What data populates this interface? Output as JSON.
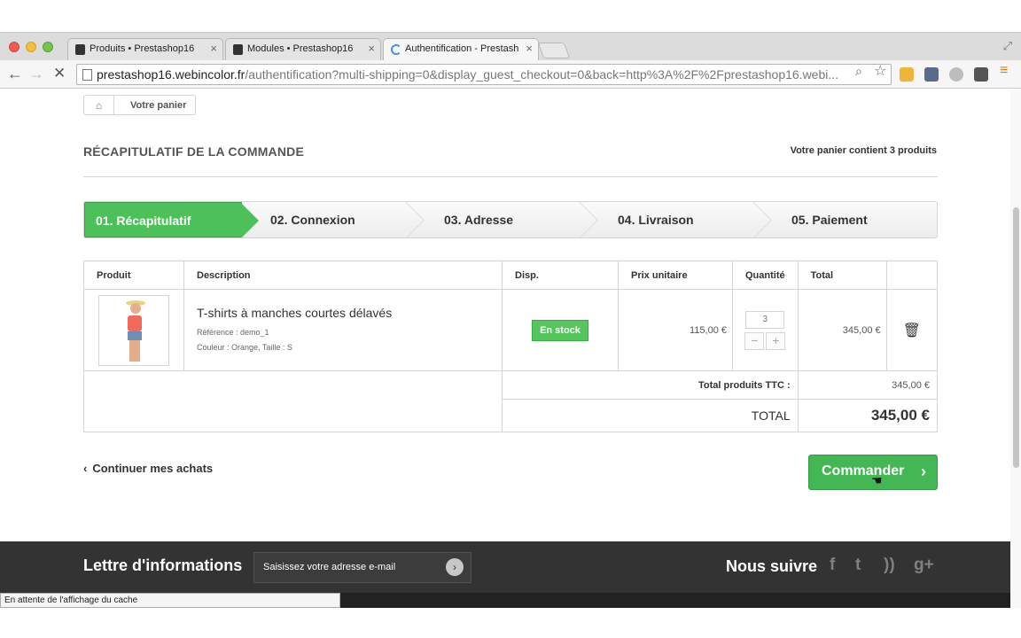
{
  "browser": {
    "tabs": [
      {
        "title": "Produits • Prestashop16"
      },
      {
        "title": "Modules • Prestashop16"
      },
      {
        "title": "Authentification - Prestash"
      }
    ],
    "url_host": "prestashop16.webincolor.fr",
    "url_path": "/authentification?multi-shipping=0&display_guest_checkout=0&back=http%3A%2F%2Fprestashop16.webi...",
    "status_text": "En attente de l'affichage du cache"
  },
  "breadcrumb": {
    "current": "Votre panier"
  },
  "page": {
    "heading": "RÉCAPITULATIF DE LA COMMANDE",
    "cart_summary": "Votre panier contient 3 produits"
  },
  "steps": [
    {
      "label": "01. Récapitulatif",
      "active": true
    },
    {
      "label": "02. Connexion"
    },
    {
      "label": "03. Adresse"
    },
    {
      "label": "04. Livraison"
    },
    {
      "label": "05. Paiement"
    }
  ],
  "cart_table": {
    "headers": [
      "Produit",
      "Description",
      "Disp.",
      "Prix unitaire",
      "Quantité",
      "Total"
    ],
    "item": {
      "name": "T-shirts à manches courtes délavés",
      "reference": "Référence : demo_1",
      "attributes": "Couleur : Orange, Taille : S",
      "availability": "En stock",
      "unit_price": "115,00 €",
      "quantity": "3",
      "total": "345,00 €"
    },
    "subtotal_label": "Total produits TTC :",
    "subtotal_value": "345,00 €",
    "total_label": "TOTAL",
    "total_value": "345,00 €"
  },
  "actions": {
    "continue_label": "Continuer mes achats",
    "order_label": "Commander"
  },
  "footer": {
    "newsletter_title": "Lettre d'informations",
    "newsletter_placeholder": "Saisissez votre adresse e-mail",
    "follow_title": "Nous suivre"
  }
}
